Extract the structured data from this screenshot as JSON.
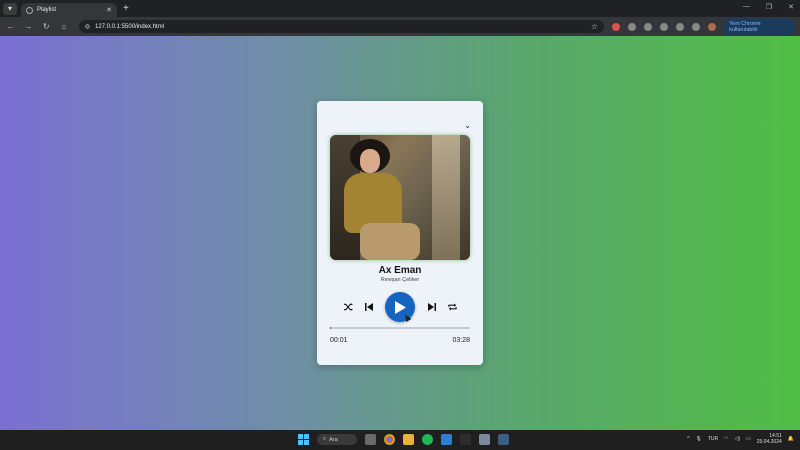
{
  "browser": {
    "tab_title": "Playlist",
    "url": "127.0.0.1:5500/index.html",
    "update_label": "Yeni Chrome kullanılabilir"
  },
  "player": {
    "title": "Ax Eman",
    "artist": "Rewşan Çeliker",
    "current_time": "00:01",
    "total_time": "03:28",
    "progress_fraction": 0.005,
    "accent_color": "#1565c0"
  },
  "taskbar": {
    "search_label": "Ara",
    "language": "TUR",
    "time": "14:51",
    "date": "25.04.2024"
  }
}
